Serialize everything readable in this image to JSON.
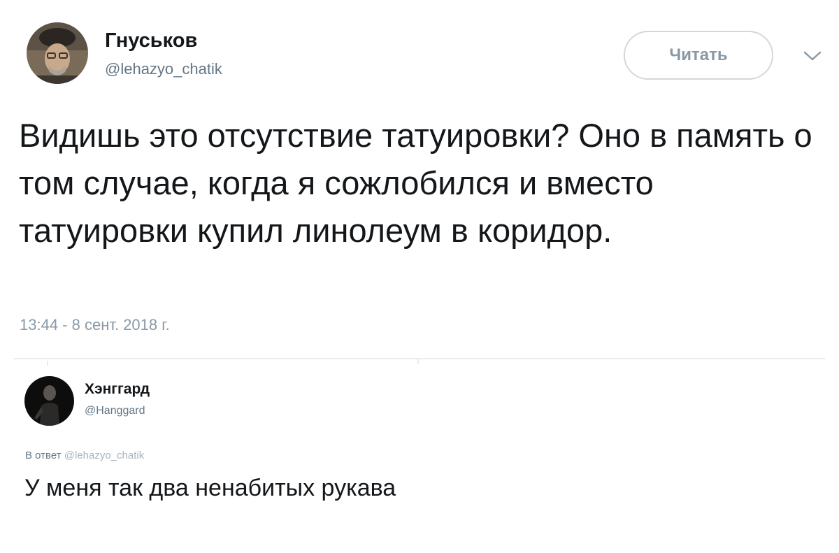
{
  "tweet": {
    "author": {
      "display_name": "Гнуськов",
      "handle": "@lehazyo_chatik"
    },
    "follow_button_label": "Читать",
    "more_icon": "chevron-down-icon",
    "text": "Видишь это отсутствие татуировки? Оно в память о том случае, когда я сожлобился и вместо татуировки купил линолеум в коридор.",
    "timestamp": "13:44 - 8 сент. 2018 г."
  },
  "reply": {
    "author": {
      "display_name": "Хэнггард",
      "handle": "@Hanggard"
    },
    "reply_to_label": "В ответ",
    "reply_to_handle": "@lehazyo_chatik",
    "text": "У меня так два ненабитых рукава"
  },
  "colors": {
    "text_primary": "#14171a",
    "text_secondary": "#657786",
    "text_muted": "#8899a6",
    "button_border": "#d3d8dc",
    "divider": "#e6ecf0"
  }
}
